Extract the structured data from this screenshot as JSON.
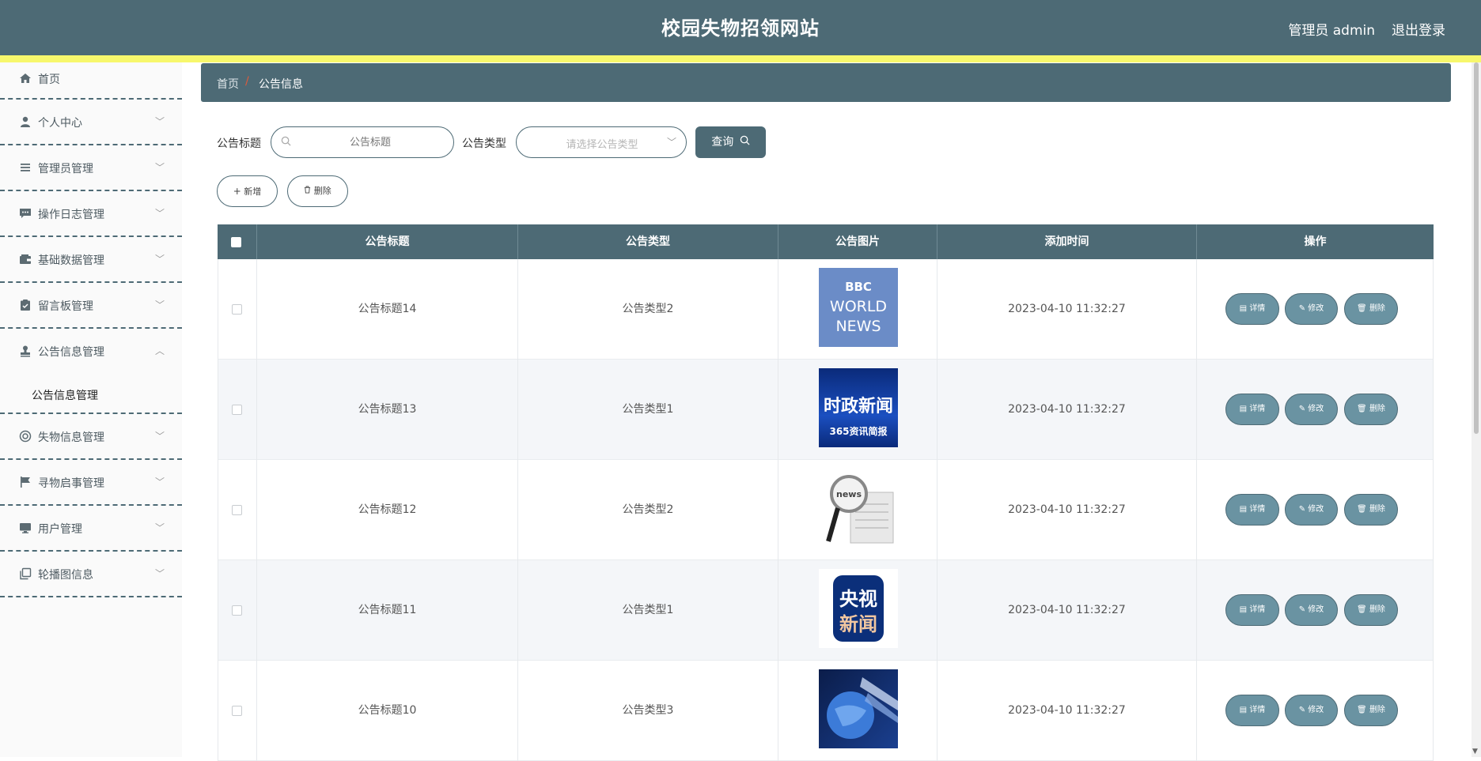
{
  "header": {
    "title": "校园失物招领网站",
    "user": "管理员 admin",
    "logout": "退出登录"
  },
  "sidebar": {
    "home": "首页",
    "items": [
      {
        "label": "个人中心"
      },
      {
        "label": "管理员管理"
      },
      {
        "label": "操作日志管理"
      },
      {
        "label": "基础数据管理"
      },
      {
        "label": "留言板管理"
      },
      {
        "label": "公告信息管理",
        "sub": "公告信息管理"
      },
      {
        "label": "失物信息管理"
      },
      {
        "label": "寻物启事管理"
      },
      {
        "label": "用户管理"
      },
      {
        "label": "轮播图信息"
      }
    ]
  },
  "breadcrumb": {
    "home": "首页",
    "sep": "/",
    "current": "公告信息"
  },
  "search": {
    "title_label": "公告标题",
    "title_placeholder": "公告标题",
    "type_label": "公告类型",
    "type_placeholder": "请选择公告类型",
    "query_label": "查询"
  },
  "actions": {
    "add": "新增",
    "delete": "删除"
  },
  "table": {
    "columns": [
      "公告标题",
      "公告类型",
      "公告图片",
      "添加时间",
      "操作"
    ],
    "row_actions": {
      "detail": "详情",
      "edit": "修改",
      "delete": "删除"
    },
    "rows": [
      {
        "title": "公告标题14",
        "type": "公告类型2",
        "time": "2023-04-10 11:32:27",
        "image": "bbc-world-news",
        "image_text": [
          "BBC",
          "WORLD",
          "NEWS"
        ]
      },
      {
        "title": "公告标题13",
        "type": "公告类型1",
        "time": "2023-04-10 11:32:27",
        "image": "current-affairs-news",
        "image_text": [
          "时政新闻",
          "365资讯简报"
        ]
      },
      {
        "title": "公告标题12",
        "type": "公告类型2",
        "time": "2023-04-10 11:32:27",
        "image": "news-magnifier",
        "image_text": [
          "news"
        ]
      },
      {
        "title": "公告标题11",
        "type": "公告类型1",
        "time": "2023-04-10 11:32:27",
        "image": "cctv-news",
        "image_text": [
          "央视",
          "新闻"
        ]
      },
      {
        "title": "公告标题10",
        "type": "公告类型3",
        "time": "2023-04-10 11:32:27",
        "image": "globe-news",
        "image_text": []
      }
    ]
  }
}
